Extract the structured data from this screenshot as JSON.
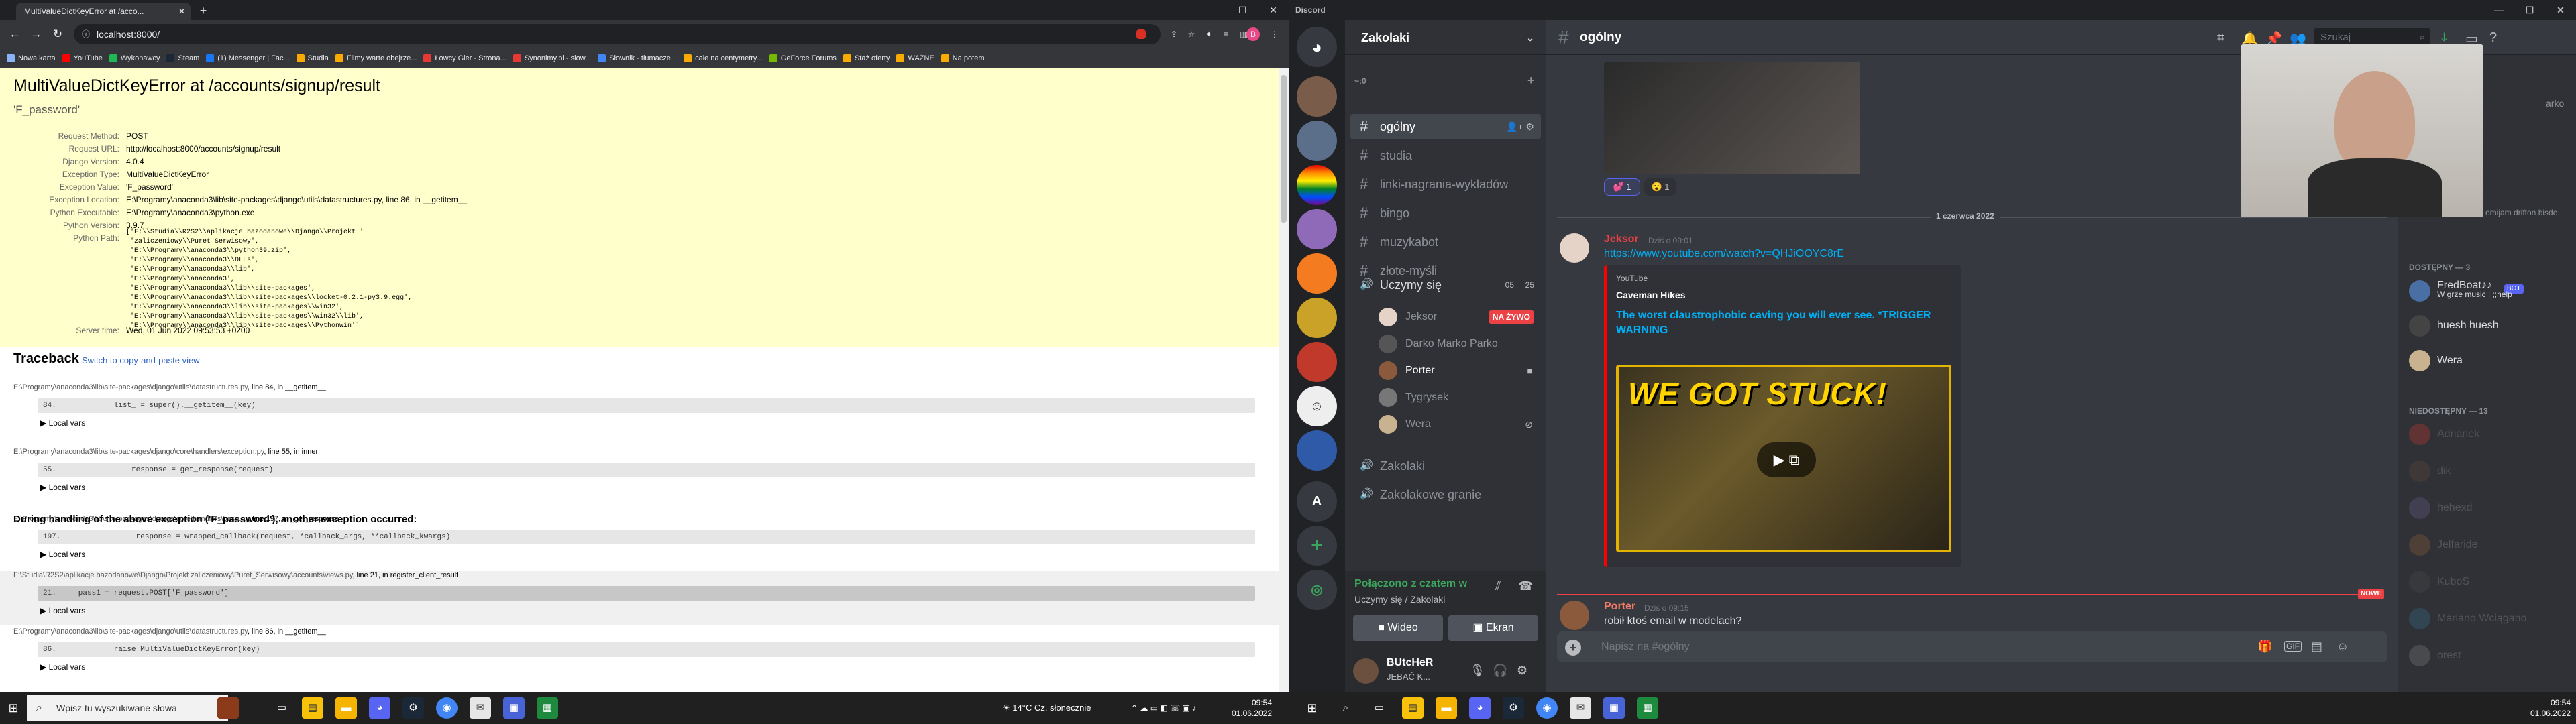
{
  "browser": {
    "tab_title": "MultiValueDictKeyError at /acco...",
    "url": "localhost:8000/",
    "bookmarks": [
      "Nowa karta",
      "YouTube",
      "Wykonawcy",
      "Steam",
      "(1) Messenger | Fac...",
      "Studia",
      "Filmy warte obejrze...",
      "Łowcy Gier - Strona...",
      "Synonimy.pl - słow...",
      "Słownik - tłumacze...",
      "całe na centymetry...",
      "GeForce Forums",
      "Staż oferty",
      "WAŻNE",
      "Na potem"
    ],
    "bookmark_colors": [
      "#8ab4f8",
      "#ff0000",
      "#1db954",
      "#1b2838",
      "#1877f2",
      "#f9ab00",
      "#f9ab00",
      "#e53935",
      "#e53935",
      "#4285f4",
      "#f9ab00",
      "#76b900",
      "#f9ab00",
      "#f9ab00",
      "#f9ab00"
    ]
  },
  "django": {
    "title": "MultiValueDictKeyError at /accounts/signup/result",
    "subtitle": "'F_password'",
    "meta": [
      {
        "k": "Request Method:",
        "v": "POST"
      },
      {
        "k": "Request URL:",
        "v": "http://localhost:8000/accounts/signup/result"
      },
      {
        "k": "Django Version:",
        "v": "4.0.4"
      },
      {
        "k": "Exception Type:",
        "v": "MultiValueDictKeyError"
      },
      {
        "k": "Exception Value:",
        "v": "'F_password'"
      },
      {
        "k": "Exception Location:",
        "v": "E:\\Programy\\anaconda3\\lib\\site-packages\\django\\utils\\datastructures.py, line 86, in __getitem__"
      },
      {
        "k": "Python Executable:",
        "v": "E:\\Programy\\anaconda3\\python.exe"
      },
      {
        "k": "Python Version:",
        "v": "3.9.7"
      },
      {
        "k": "Python Path:",
        "v": ""
      }
    ],
    "python_path": "['F:\\\\Studia\\\\R2S2\\\\aplikacje bazodanowe\\\\Django\\\\Projekt '\n 'zaliczeniowy\\\\Puret_Serwisowy',\n 'E:\\\\Programy\\\\anaconda3\\\\python39.zip',\n 'E:\\\\Programy\\\\anaconda3\\\\DLLs',\n 'E:\\\\Programy\\\\anaconda3\\\\lib',\n 'E:\\\\Programy\\\\anaconda3',\n 'E:\\\\Programy\\\\anaconda3\\\\lib\\\\site-packages',\n 'E:\\\\Programy\\\\anaconda3\\\\lib\\\\site-packages\\\\locket-0.2.1-py3.9.egg',\n 'E:\\\\Programy\\\\anaconda3\\\\lib\\\\site-packages\\\\win32',\n 'E:\\\\Programy\\\\anaconda3\\\\lib\\\\site-packages\\\\win32\\\\lib',\n 'E:\\\\Programy\\\\anaconda3\\\\lib\\\\site-packages\\\\Pythonwin']",
    "server_time_label": "Server time:",
    "server_time": "Wed, 01 Jun 2022 09:53:53 +0200",
    "traceback_title": "Traceback",
    "switch_link": "Switch to copy-and-paste view",
    "during_text": "During handling of the above exception ('F_password'), another exception occurred:",
    "local_vars": "▶ Local vars",
    "frames": [
      {
        "path": "E:\\Programy\\anaconda3\\lib\\site-packages\\django\\utils\\datastructures.py",
        "info": ", line 84, in __getitem__",
        "code": "84.             list_ = super().__getitem__(key)"
      },
      {
        "path": "E:\\Programy\\anaconda3\\lib\\site-packages\\django\\core\\handlers\\exception.py",
        "info": ", line 55, in inner",
        "code": "55.                 response = get_response(request)"
      },
      {
        "path": "E:\\Programy\\anaconda3\\lib\\site-packages\\django\\core\\handlers\\base.py",
        "info": ", line 197, in _get_response",
        "code": "197.                 response = wrapped_callback(request, *callback_args, **callback_kwargs)"
      },
      {
        "path": "F:\\Studia\\R2S2\\aplikacje bazodanowe\\Django\\Projekt zaliczeniowy\\Puret_Serwisowy\\accounts\\views.py",
        "info": ", line 21, in register_client_result",
        "code": "21.     pass1 = request.POST['F_password']"
      },
      {
        "path": "E:\\Programy\\anaconda3\\lib\\site-packages\\django\\utils\\datastructures.py",
        "info": ", line 86, in __getitem__",
        "code": "86.             raise MultiValueDictKeyError(key)"
      }
    ]
  },
  "discord": {
    "app_title": "Discord",
    "guild": "Zakolaki",
    "category": "~:0",
    "channels": [
      "ogólny",
      "studia",
      "linki-nagrania-wykładów",
      "bingo",
      "muzykabot",
      "złote-myśli"
    ],
    "voice_channel": "Uczymy się",
    "voice_counts": [
      "05",
      "25"
    ],
    "voice_users": [
      {
        "name": "Jeksor",
        "live": "NA ŻYWO"
      },
      {
        "name": "Darko Marko Parko",
        "live": ""
      },
      {
        "name": "Porter",
        "live": ""
      },
      {
        "name": "Tygrysek",
        "live": ""
      },
      {
        "name": "Wera",
        "live": ""
      }
    ],
    "voice_channels_more": [
      "Zakolaki",
      "Zakolakowe granie"
    ],
    "connected": "Połączono z czatem w",
    "connected_sub": "Uczymy się / Zakolaki",
    "video_btn": "Wideo",
    "screen_btn": "Ekran",
    "user_name": "BUtcHeR",
    "user_status": "JEBAĆ K...",
    "chat_title": "ogólny",
    "search_placeholder": "Szukaj",
    "reactions": [
      "1",
      "1"
    ],
    "date_divider": "1 czerwca 2022",
    "messages": [
      {
        "author": "Jeksor",
        "time": "Dziś o 09:01",
        "link": "https://www.youtube.com/watch?v=QHJiOOYC8rE"
      },
      {
        "author": "Porter",
        "time": "Dziś o 09:15",
        "text": "robił ktoś email w modelach?"
      }
    ],
    "embed": {
      "provider": "YouTube",
      "author": "Caveman Hikes",
      "title": "The worst claustrophobic caving you will ever see. *TRIGGER WARNING",
      "thumb_text": "WE GOT STUCK!"
    },
    "new_label": "NOWE",
    "composer_placeholder": "Napisz na #ogólny",
    "gif_label": "GIF",
    "members_partial": "omijam drifton bisde",
    "members_partial2": "arko",
    "online_header": "DOSTĘPNY — 3",
    "online": [
      {
        "name": "FredBoat♪♪",
        "sub": "W grze music | ;;help",
        "bot": "BOT"
      },
      {
        "name": "huesh huesh",
        "sub": ""
      },
      {
        "name": "Wera",
        "sub": ""
      }
    ],
    "offline_header": "NIEDOSTĘPNY — 13",
    "offline": [
      "Adrianek",
      "dik",
      "hehexd",
      "Jelfaride",
      "KuboS",
      "Mariano Wciągano",
      "orest"
    ],
    "colors": {
      "accent": "#5865f2",
      "online": "#3ba55d",
      "live": "#ed4245",
      "link": "#00aff4"
    }
  },
  "taskbar": {
    "search_placeholder": "Wpisz tu wyszukiwane słowa",
    "weather": "14°C  Cz. słonecznie",
    "time": "09:54",
    "date": "01.06.2022"
  }
}
